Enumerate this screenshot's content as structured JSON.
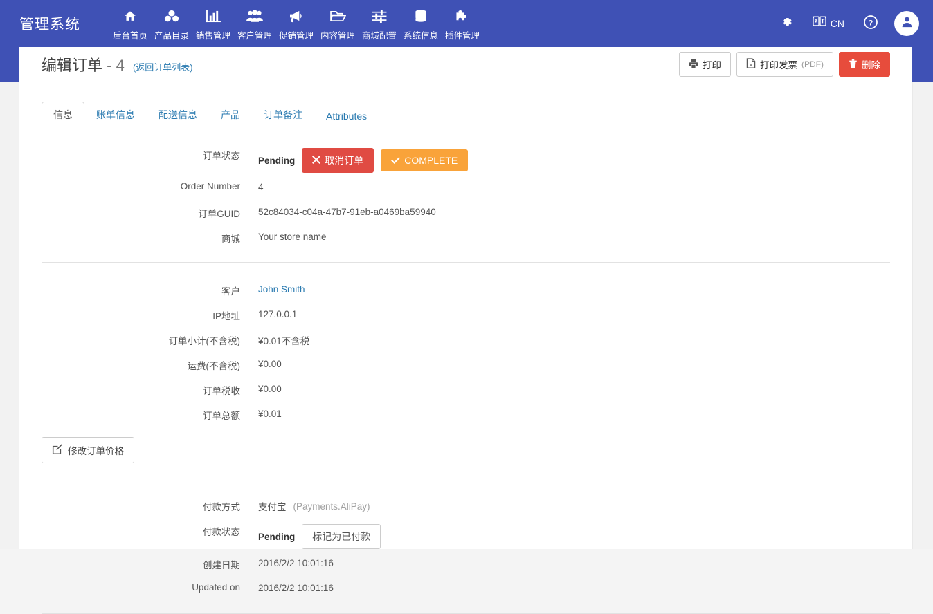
{
  "navbar": {
    "brand": "管理系统",
    "items": [
      {
        "label": "后台首页",
        "icon": "home-icon"
      },
      {
        "label": "产品目录",
        "icon": "cubes-icon"
      },
      {
        "label": "销售管理",
        "icon": "bar-chart-icon"
      },
      {
        "label": "客户管理",
        "icon": "users-icon"
      },
      {
        "label": "促销管理",
        "icon": "bullhorn-icon"
      },
      {
        "label": "内容管理",
        "icon": "folder-open-icon"
      },
      {
        "label": "商城配置",
        "icon": "sliders-icon"
      },
      {
        "label": "系统信息",
        "icon": "database-icon"
      },
      {
        "label": "插件管理",
        "icon": "puzzle-piece-icon"
      }
    ],
    "right": {
      "settings_icon": "gear-icon",
      "language_icon": "language-icon",
      "language_label": "CN",
      "help_icon": "question-circle-icon",
      "account_icon": "user-icon"
    }
  },
  "titlebar": {
    "title": "编辑订单",
    "separator": "-",
    "order_number": "4",
    "back_link": "(返回订单列表)",
    "actions": [
      {
        "label": "打印",
        "icon": "printer-icon",
        "style": "default"
      },
      {
        "label": "打印发票",
        "suffix": "(PDF)",
        "icon": "file-pdf-icon",
        "style": "default"
      },
      {
        "label": "删除",
        "icon": "trash-icon",
        "style": "danger"
      }
    ]
  },
  "tabs": [
    {
      "label": "信息",
      "active": true
    },
    {
      "label": "账单信息",
      "active": false
    },
    {
      "label": "配送信息",
      "active": false
    },
    {
      "label": "产品",
      "active": false
    },
    {
      "label": "订单备注",
      "active": false
    },
    {
      "label": "Attributes",
      "active": false
    }
  ],
  "order": {
    "status_label": "订单状态",
    "status_value": "Pending",
    "cancel_button": "取消订单",
    "complete_button": "COMPLETE",
    "order_number_label": "Order Number",
    "order_number_value": "4",
    "guid_label": "订单GUID",
    "guid_value": "52c84034-c04a-47b7-91eb-a0469ba59940",
    "store_label": "商城",
    "store_value": "Your store name"
  },
  "customer": {
    "customer_label": "客户",
    "customer_value": "John Smith",
    "ip_label": "IP地址",
    "ip_value": "127.0.0.1",
    "subtotal_label": "订单小计(不含税)",
    "subtotal_value": "¥0.01不含税",
    "shipping_label": "运费(不含税)",
    "shipping_value": "¥0.00",
    "tax_label": "订单税收",
    "tax_value": "¥0.00",
    "total_label": "订单总额",
    "total_value": "¥0.01",
    "edit_price_button": "修改订单价格"
  },
  "payment": {
    "method_label": "付款方式",
    "method_value": "支付宝",
    "method_system": "(Payments.AliPay)",
    "status_label": "付款状态",
    "status_value": "Pending",
    "mark_paid_button": "标记为已付款",
    "created_label": "创建日期",
    "created_value": "2016/2/2 10:01:16",
    "updated_label": "Updated on",
    "updated_value": "2016/2/2 10:01:16"
  },
  "colors": {
    "header_blue": "#3f51b5",
    "danger_red": "#e74c3c",
    "cancel_red": "#e04b43",
    "complete_orange": "#f9a33a",
    "link_blue": "#2a7ab0"
  }
}
